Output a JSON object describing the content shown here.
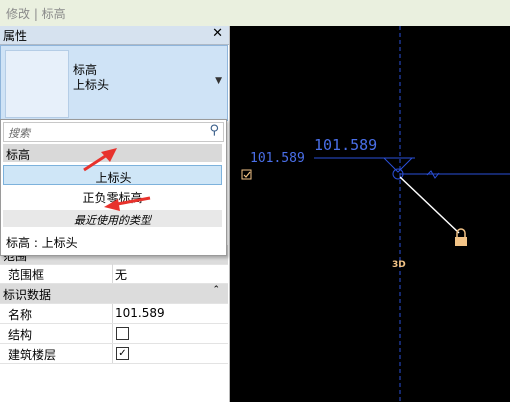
{
  "window": {
    "title": "修改 | 标高"
  },
  "properties": {
    "title": "属性",
    "close_icon": "close-icon",
    "type_selector": {
      "line1": "标高",
      "line2": "上标头"
    }
  },
  "dropdown": {
    "search_placeholder": "搜索",
    "group": "标高",
    "options": [
      "上标头",
      "正负零标高"
    ],
    "selected_option": "上标头",
    "recent_label": "最近使用的类型",
    "footer": "标高 : 上标头"
  },
  "props": {
    "section_partial": "范围",
    "range_box_label": "范围框",
    "range_box_value": "无",
    "identity_section": "标识数据",
    "name_label": "名称",
    "name_value": "101.589",
    "structure_label": "结构",
    "structure_checked": false,
    "building_story_label": "建筑楼层",
    "building_story_checked": true
  },
  "canvas": {
    "level_value_left": "101.589",
    "level_value_right": "101.589",
    "label_3d": "3D",
    "accent_color": "#2a4fd8",
    "background": "#000000"
  },
  "annotations": {
    "arrow_color": "#e8322c"
  }
}
